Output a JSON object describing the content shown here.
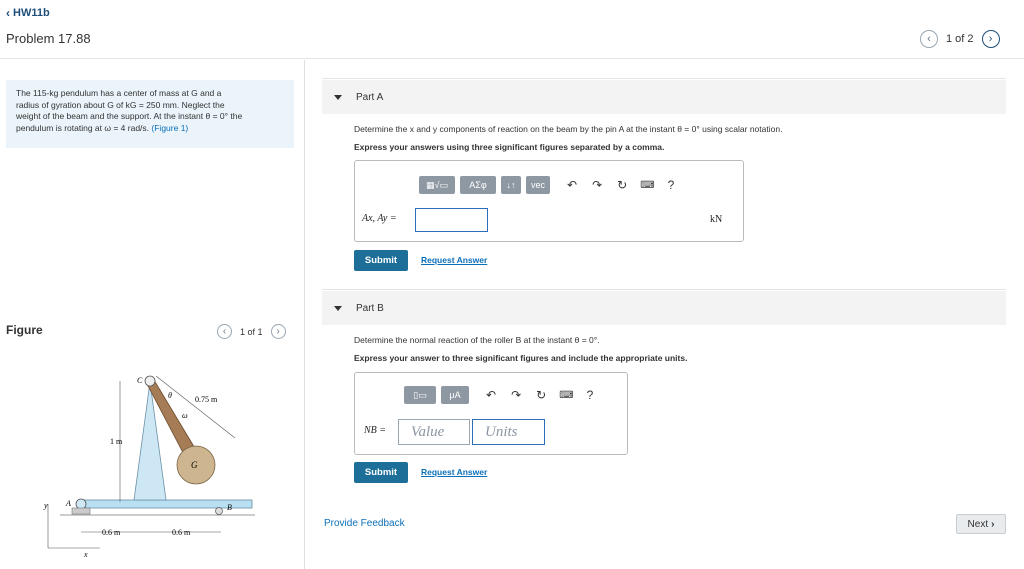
{
  "nav": {
    "back_label": "HW11b"
  },
  "problem": {
    "title": "Problem 17.88",
    "pager_text": "1 of 2"
  },
  "statement": {
    "line1": "The 115-kg pendulum has a center of mass at G and a",
    "line2": "radius of gyration about G of kG = 250 mm. Neglect the",
    "line3": "weight of the beam and the support. At the instant θ = 0° the",
    "line4": "pendulum is rotating at ω = 4 rad/s.",
    "figure_link": "(Figure 1)"
  },
  "figure": {
    "label": "Figure",
    "pager_text": "1 of 1",
    "labels": {
      "C": "C",
      "theta": "θ",
      "omega": "ω",
      "dim_075": "0.75 m",
      "dim_1m": "1 m",
      "G": "G",
      "A": "A",
      "B": "B",
      "y": "y",
      "x": "x",
      "dim_06a": "0.6 m",
      "dim_06b": "0.6 m"
    }
  },
  "part_a": {
    "title": "Part A",
    "question": "Determine the x and y components of reaction on the beam by the pin A at the instant θ = 0° using scalar notation.",
    "instruction": "Express your answers using three significant figures separated by a comma.",
    "toolbar": {
      "matrix": "▦√▭",
      "greek": "ΑΣφ",
      "arrows": "↓↑",
      "vec": "vec",
      "help": "?"
    },
    "answer_label": "Ax, Ay =",
    "answer_value": "",
    "unit": "kN",
    "submit_label": "Submit",
    "request_label": "Request Answer"
  },
  "part_b": {
    "title": "Part B",
    "question": "Determine the normal reaction of the roller B at the instant θ = 0°.",
    "instruction": "Express your answer to three significant figures and include the appropriate units.",
    "toolbar": {
      "templates": "▯▭",
      "mu": "μA",
      "help": "?"
    },
    "answer_label": "NB =",
    "value_placeholder": "Value",
    "units_placeholder": "Units",
    "submit_label": "Submit",
    "request_label": "Request Answer"
  },
  "footer": {
    "feedback_label": "Provide Feedback",
    "next_label": "Next"
  },
  "colors": {
    "accent": "#1d6f9a",
    "link": "#0a6fb8",
    "problem_bg": "#eaf4fa",
    "toolbar_gray": "#8e98a3"
  }
}
